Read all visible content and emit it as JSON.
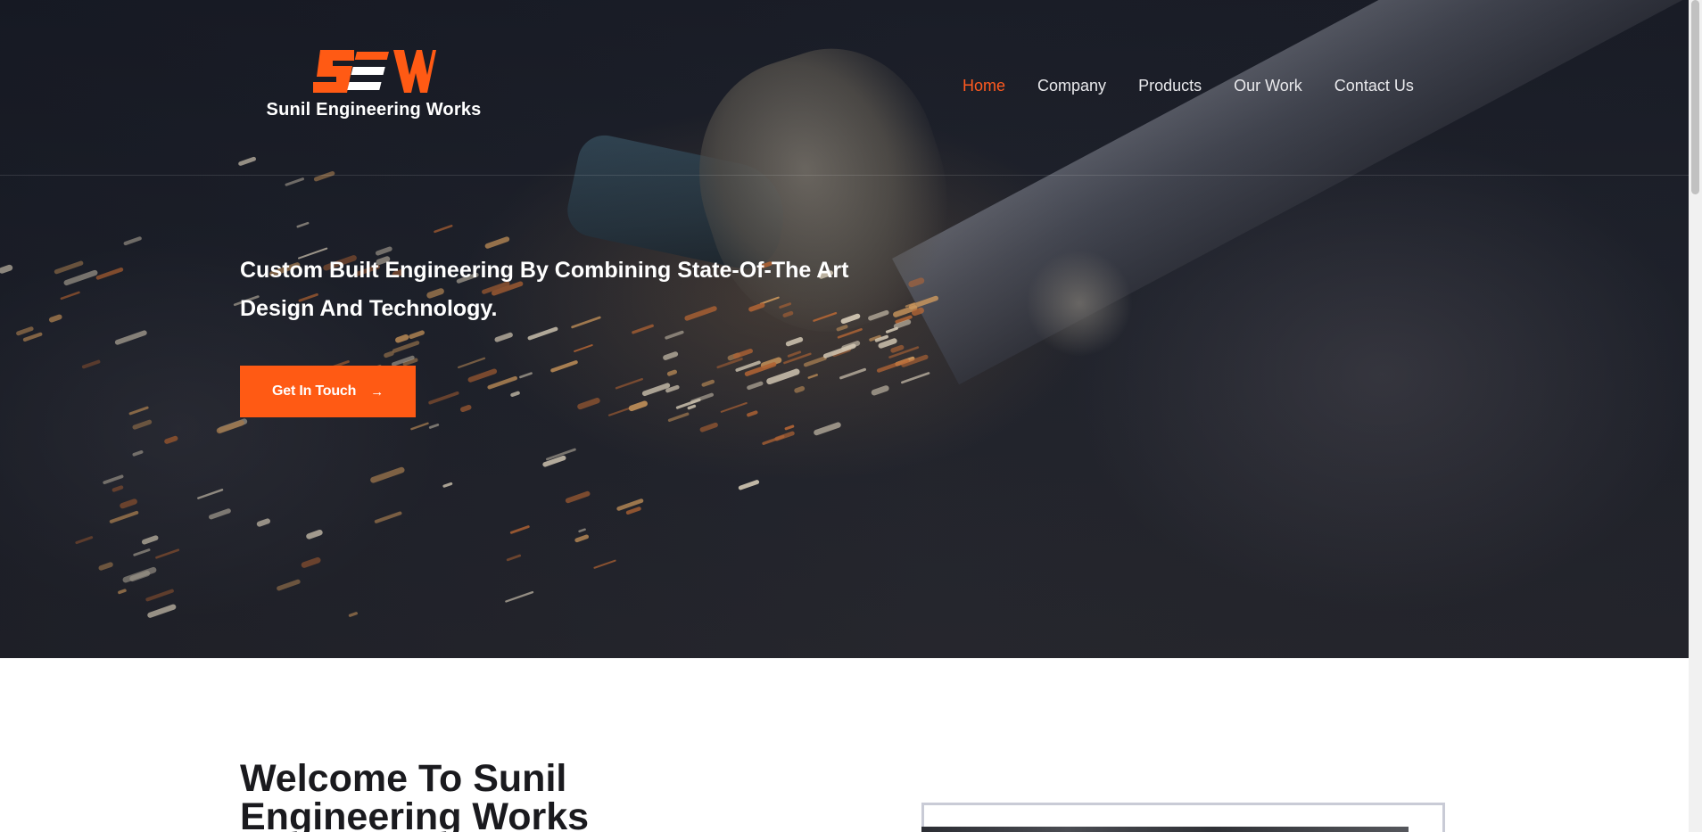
{
  "brand": {
    "logo_letters": "SEW",
    "name": "Sunil Engineering Works",
    "accent_color": "#ff5a14"
  },
  "nav": {
    "items": [
      {
        "label": "Home",
        "active": true
      },
      {
        "label": "Company",
        "active": false
      },
      {
        "label": "Products",
        "active": false
      },
      {
        "label": "Our Work",
        "active": false
      },
      {
        "label": "Contact Us",
        "active": false
      }
    ]
  },
  "hero": {
    "title": "Custom Built Engineering By Combining State-Of-The Art Design And Technology.",
    "cta_label": "Get In Touch",
    "cta_icon": "arrow-right-icon"
  },
  "welcome": {
    "heading": "Welcome To Sunil Engineering Works"
  }
}
